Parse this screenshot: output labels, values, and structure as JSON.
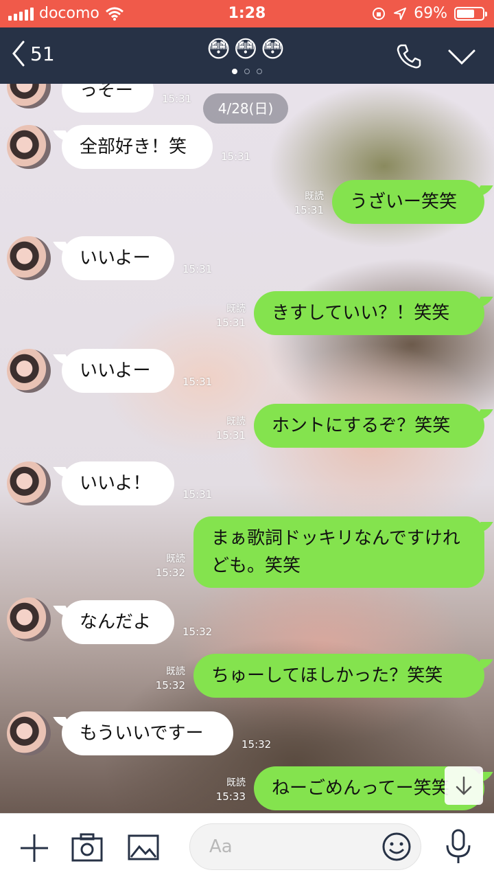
{
  "status_bar": {
    "carrier": "docomo",
    "time": "1:28",
    "battery": "69%",
    "battery_level": 0.69
  },
  "header": {
    "back_count": "51",
    "title": "😳😳😳",
    "page_dots": 3,
    "active_dot": 0
  },
  "date_label": "4/28(日)",
  "messages": [
    {
      "dir": "in",
      "text": "っそー",
      "time": "15:31"
    },
    {
      "dir": "in",
      "text": "全部好き！笑",
      "time": "15:31"
    },
    {
      "dir": "out",
      "text": "うざいー笑笑",
      "read": "既読",
      "time": "15:31"
    },
    {
      "dir": "in",
      "text": "いいよー",
      "time": "15:31"
    },
    {
      "dir": "out",
      "text": "きすしていい？！笑笑",
      "read": "既読",
      "time": "15:31"
    },
    {
      "dir": "in",
      "text": "いいよー",
      "time": "15:31"
    },
    {
      "dir": "out",
      "text": "ホントにするぞ？笑笑",
      "read": "既読",
      "time": "15:31"
    },
    {
      "dir": "in",
      "text": "いいよ！",
      "time": "15:31"
    },
    {
      "dir": "out",
      "text": "まぁ歌詞ドッキリなんですけれども。笑笑",
      "read": "既読",
      "time": "15:32"
    },
    {
      "dir": "in",
      "text": "なんだよ",
      "time": "15:32"
    },
    {
      "dir": "out",
      "text": "ちゅーしてほしかった？笑笑",
      "read": "既読",
      "time": "15:32"
    },
    {
      "dir": "in",
      "text": "もういいですー",
      "time": "15:32"
    },
    {
      "dir": "out",
      "text": "ねーごめんってー笑笑",
      "read": "既読",
      "time": "15:33"
    }
  ],
  "input": {
    "placeholder": "Aa"
  },
  "colors": {
    "status_bar": "#f05a4a",
    "header": "#273246",
    "outgoing_bubble": "#84e34e",
    "incoming_bubble": "#ffffff"
  },
  "icons": {
    "header": [
      "back-chevron-icon",
      "phone-icon",
      "chevron-down-icon"
    ],
    "input_bar": [
      "plus-icon",
      "camera-icon",
      "image-icon",
      "emoji-icon",
      "microphone-icon"
    ],
    "chat": [
      "scroll-down-icon"
    ]
  }
}
